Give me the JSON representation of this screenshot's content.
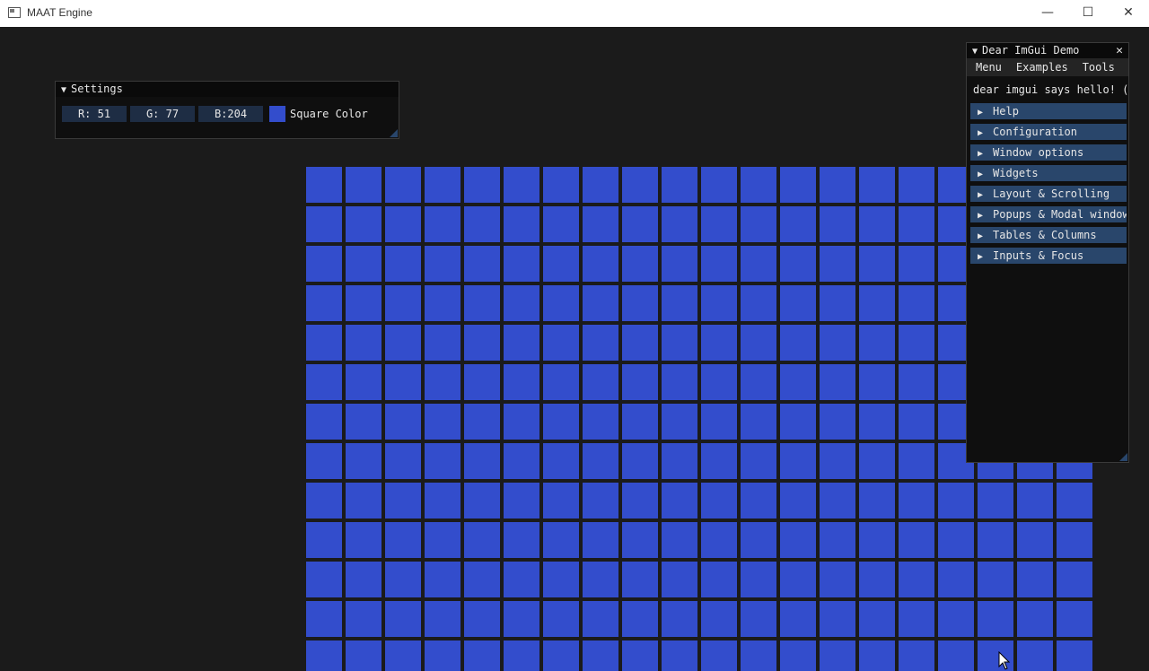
{
  "window": {
    "title": "MAAT Engine",
    "minimize_glyph": "—",
    "maximize_glyph": "☐",
    "close_glyph": "✕"
  },
  "scene": {
    "square_color": "#334dcc",
    "grid_rows": 13,
    "grid_cols": 20
  },
  "settings": {
    "title": "Settings",
    "collapse_glyph": "▼",
    "r": "R: 51",
    "g": "G: 77",
    "b": "B:204",
    "color_label": "Square Color"
  },
  "demo": {
    "title": "Dear ImGui Demo",
    "collapse_glyph": "▼",
    "close_glyph": "✕",
    "menu": [
      "Menu",
      "Examples",
      "Tools"
    ],
    "hello": "dear imgui says hello! (:",
    "headers": [
      "Help",
      "Configuration",
      "Window options",
      "Widgets",
      "Layout & Scrolling",
      "Popups & Modal windows",
      "Tables & Columns",
      "Inputs & Focus"
    ],
    "header_glyph": "▶"
  },
  "icons": {
    "app": "app-window-icon",
    "cursor": "mouse-pointer-icon"
  },
  "colors": {
    "background": "#1b1b1b",
    "header": "#29466b",
    "slider": "#1e2d44"
  }
}
